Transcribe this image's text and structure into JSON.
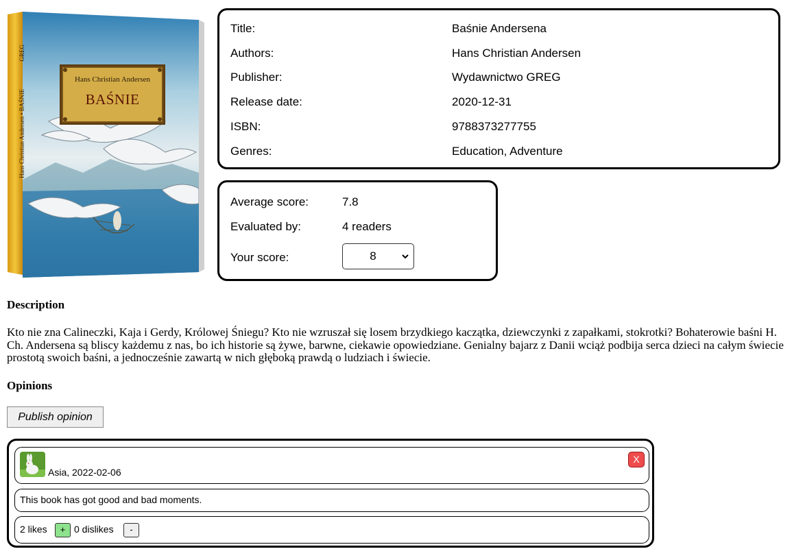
{
  "cover": {
    "author": "Hans Christian Andersen",
    "title": "BAŚNIE",
    "spine": "Hans Christian Andersen • BAŚNIE",
    "spine_publisher": "GREG"
  },
  "details": {
    "title_label": "Title:",
    "title_value": "Baśnie Andersena",
    "authors_label": "Authors:",
    "authors_value": "Hans Christian Andersen",
    "publisher_label": "Publisher:",
    "publisher_value": "Wydawnictwo GREG",
    "release_label": "Release date:",
    "release_value": "2020-12-31",
    "isbn_label": "ISBN:",
    "isbn_value": "9788373277755",
    "genres_label": "Genres:",
    "genres_value": "Education, Adventure"
  },
  "score": {
    "average_label": "Average score:",
    "average_value": "7.8",
    "evaluated_label": "Evaluated by:",
    "evaluated_value": "4 readers",
    "your_label": "Your score:",
    "your_value": "8"
  },
  "description": {
    "heading": "Description",
    "text": "Kto nie zna Calineczki, Kaja i Gerdy, Królowej Śniegu? Kto nie wzruszał się losem brzydkiego kaczątka, dziewczynki z zapałkami, stokrotki? Bohaterowie baśni H. Ch. Andersena są bliscy każdemu z nas, bo ich historie są żywe, barwne, ciekawie opowiedziane. Genialny bajarz z Danii wciąż podbija serca dzieci na całym świecie prostotą swoich baśni, a jednocześnie zawartą w nich głęboką prawdą o ludziach i świecie."
  },
  "opinions": {
    "heading": "Opinions",
    "publish_label": "Publish opinion",
    "items": [
      {
        "author_date": "Asia, 2022-02-06",
        "delete_label": "X",
        "text": "This book has got good and bad moments.",
        "likes_text": "2 likes",
        "like_button": "+",
        "dislikes_text": "0 dislikes",
        "dislike_button": "-"
      }
    ]
  },
  "colors": {
    "cover_spine": "#e9b21e",
    "delete_button": "#ee4c4c",
    "like_button": "#8de38d"
  }
}
